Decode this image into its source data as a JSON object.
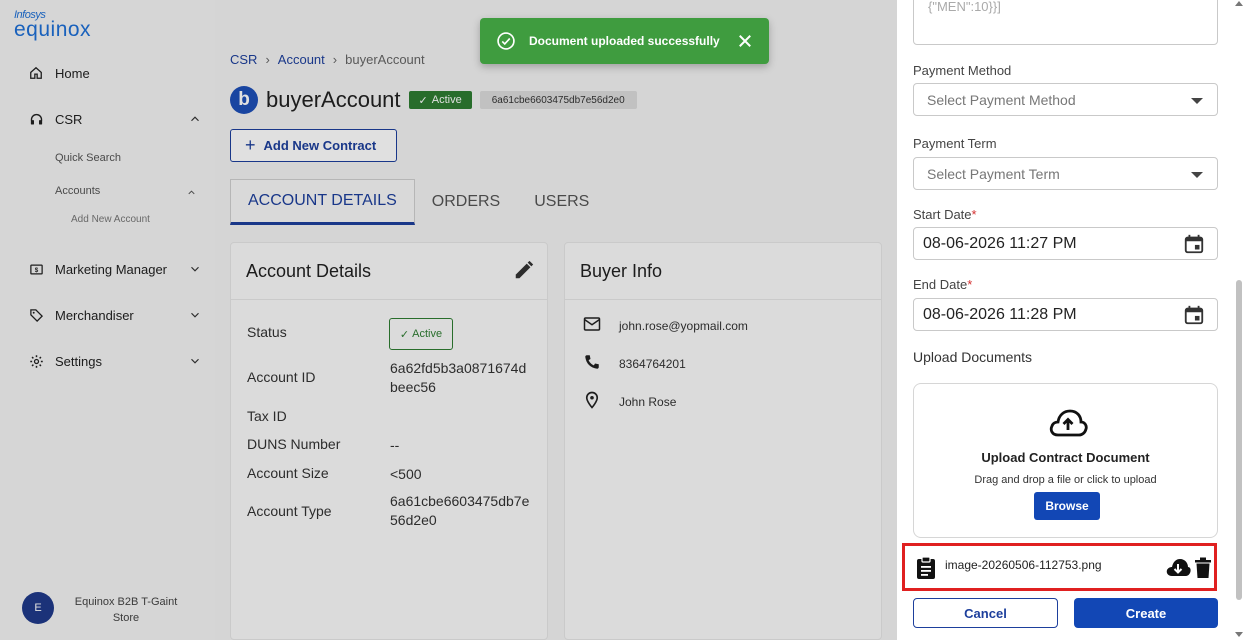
{
  "logo": {
    "line1": "Infosys",
    "line2": "equinox"
  },
  "sidebar": {
    "items": [
      {
        "label": "Home",
        "icon": "home-icon"
      },
      {
        "label": "CSR",
        "icon": "headset-icon"
      },
      {
        "label": "Marketing Manager",
        "icon": "dollar-icon"
      },
      {
        "label": "Merchandiser",
        "icon": "tag-icon"
      },
      {
        "label": "Settings",
        "icon": "gear-icon"
      }
    ],
    "sub_items": [
      "Quick Search",
      "Accounts",
      "Add New Account"
    ],
    "store": {
      "initial": "E",
      "name": "Equinox B2B T-Gaint Store"
    }
  },
  "breadcrumb": [
    "CSR",
    "Account",
    "buyerAccount"
  ],
  "account": {
    "avatar_letter": "b",
    "name": "buyerAccount",
    "status": "Active",
    "id_chip": "6a61cbe6603475db7e56d2e0"
  },
  "add_contract_label": "Add New Contract",
  "tabs": [
    "ACCOUNT DETAILS",
    "ORDERS",
    "USERS"
  ],
  "account_details": {
    "title": "Account Details",
    "status_label": "Status",
    "status_value": "Active",
    "account_id_label": "Account ID",
    "account_id_value": "6a62fd5b3a0871674dbeec56",
    "tax_id_label": "Tax ID",
    "duns_label": "DUNS Number",
    "duns_value": "--",
    "size_label": "Account Size",
    "size_value": "<500",
    "type_label": "Account Type",
    "type_value": "6a61cbe6603475db7e56d2e0"
  },
  "buyer_info": {
    "title": "Buyer Info",
    "email": "john.rose@yopmail.com",
    "phone": "8364764201",
    "name": "John Rose"
  },
  "toast": {
    "message": "Document uploaded successfully"
  },
  "drawer": {
    "json_text": "{\"MEN\":10}}]",
    "payment_method_label": "Payment Method",
    "payment_method_placeholder": "Select Payment Method",
    "payment_term_label": "Payment Term",
    "payment_term_placeholder": "Select Payment Term",
    "start_date_label": "Start Date",
    "start_date_value": "08-06-2026 11:27 PM",
    "end_date_label": "End Date",
    "end_date_value": "08-06-2026 11:28 PM",
    "upload_label": "Upload Documents",
    "upload_title": "Upload Contract Document",
    "upload_sub": "Drag and drop a file or click to upload",
    "browse_label": "Browse",
    "file_name": "image-20260506-112753.png",
    "cancel_label": "Cancel",
    "create_label": "Create"
  }
}
